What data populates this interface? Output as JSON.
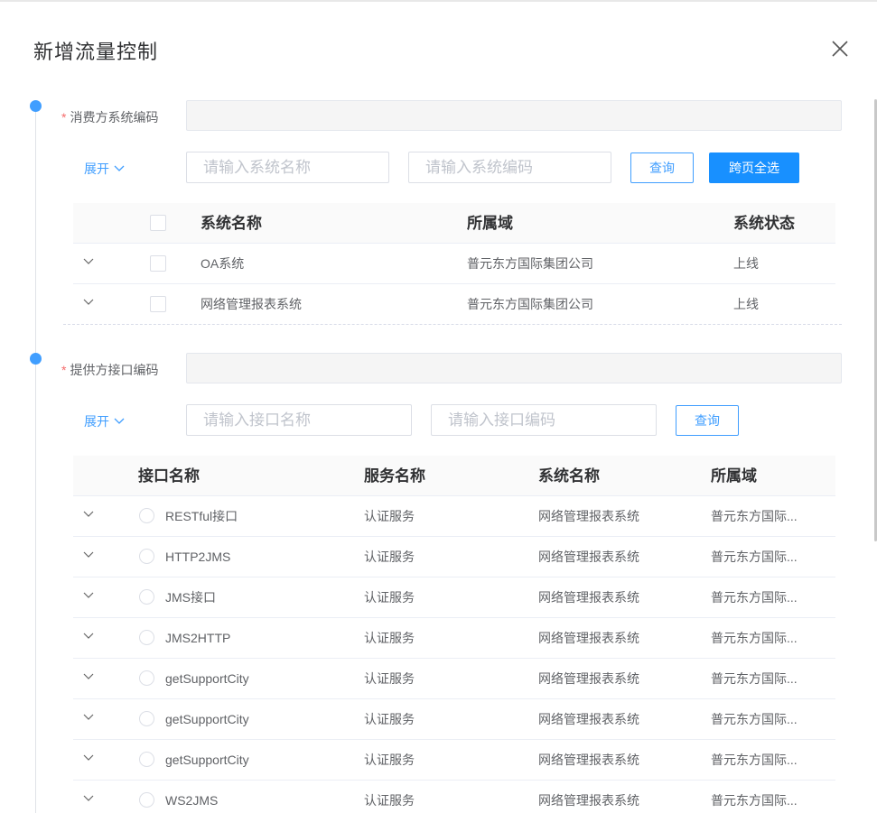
{
  "modal": {
    "title": "新增流量控制"
  },
  "consumer": {
    "label": "消费方系统编码",
    "required_mark": "*",
    "expand_label": "展开",
    "search_name_placeholder": "请输入系统名称",
    "search_code_placeholder": "请输入系统编码",
    "query_label": "查询",
    "select_all_label": "跨页全选",
    "columns": [
      "系统名称",
      "所属域",
      "系统状态"
    ],
    "rows": [
      {
        "name": "OA系统",
        "domain": "普元东方国际集团公司",
        "status": "上线"
      },
      {
        "name": "网络管理报表系统",
        "domain": "普元东方国际集团公司",
        "status": "上线"
      }
    ]
  },
  "provider": {
    "label": "提供方接口编码",
    "required_mark": "*",
    "expand_label": "展开",
    "search_name_placeholder": "请输入接口名称",
    "search_code_placeholder": "请输入接口编码",
    "query_label": "查询",
    "columns": [
      "接口名称",
      "服务名称",
      "系统名称",
      "所属域"
    ],
    "rows": [
      {
        "interface": "RESTful接口",
        "service": "认证服务",
        "system": "网络管理报表系统",
        "domain": "普元东方国际..."
      },
      {
        "interface": "HTTP2JMS",
        "service": "认证服务",
        "system": "网络管理报表系统",
        "domain": "普元东方国际..."
      },
      {
        "interface": "JMS接口",
        "service": "认证服务",
        "system": "网络管理报表系统",
        "domain": "普元东方国际..."
      },
      {
        "interface": "JMS2HTTP",
        "service": "认证服务",
        "system": "网络管理报表系统",
        "domain": "普元东方国际..."
      },
      {
        "interface": "getSupportCity",
        "service": "认证服务",
        "system": "网络管理报表系统",
        "domain": "普元东方国际..."
      },
      {
        "interface": "getSupportCity",
        "service": "认证服务",
        "system": "网络管理报表系统",
        "domain": "普元东方国际..."
      },
      {
        "interface": "getSupportCity",
        "service": "认证服务",
        "system": "网络管理报表系统",
        "domain": "普元东方国际..."
      },
      {
        "interface": "WS2JMS",
        "service": "认证服务",
        "system": "网络管理报表系统",
        "domain": "普元东方国际..."
      }
    ]
  },
  "colors": {
    "primary": "#409eff",
    "primary_button": "#1890ff",
    "required": "#f56c6c"
  }
}
